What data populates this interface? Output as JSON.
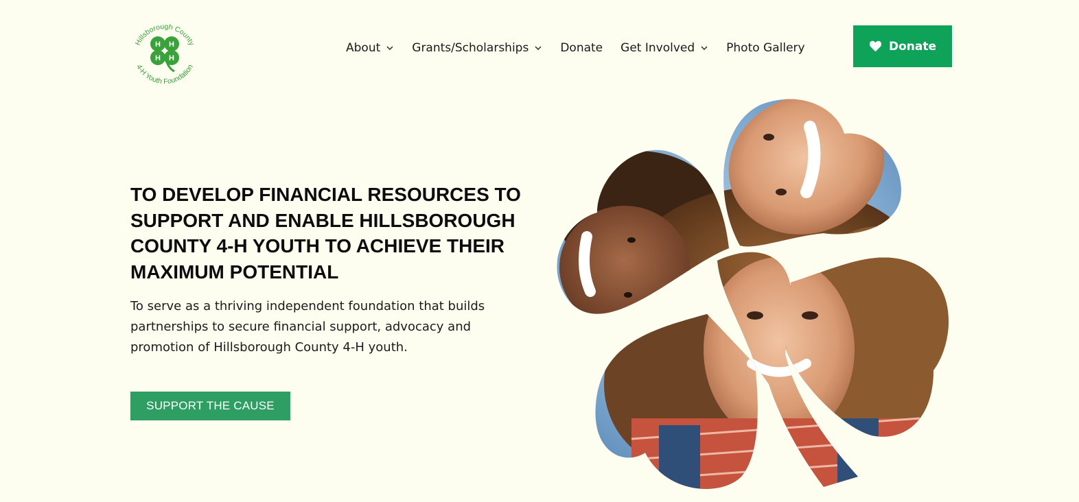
{
  "header": {
    "logo": {
      "ring_text_top": "Hillsborough County",
      "ring_text_bottom": "4-H Youth Foundation",
      "icon": "four-leaf-clover-logo-icon"
    },
    "nav": {
      "about": "About",
      "grants": "Grants/Scholarships",
      "donate": "Donate",
      "get_involved": "Get Involved",
      "photo_gallery": "Photo Gallery"
    },
    "donate_button": "Donate"
  },
  "hero": {
    "title": "TO DEVELOP FINANCIAL RESOURCES TO SUPPORT AND ENABLE HILLSBOROUGH COUNTY 4-H YOUTH TO ACHIEVE THEIR MAXIMUM POTENTIAL",
    "text": "To serve as a thriving independent foundation that builds partnerships to secure financial support, advocacy and promotion of Hillsborough County 4-H youth.",
    "cta": "SUPPORT THE CAUSE",
    "image": "four-leaf-clover-shaped photo of three smiling children"
  },
  "colors": {
    "background": "#fdfdf0",
    "brand_green": "#0fa35a",
    "cta_green": "#2e9e63",
    "logo_green": "#3aa23a"
  }
}
